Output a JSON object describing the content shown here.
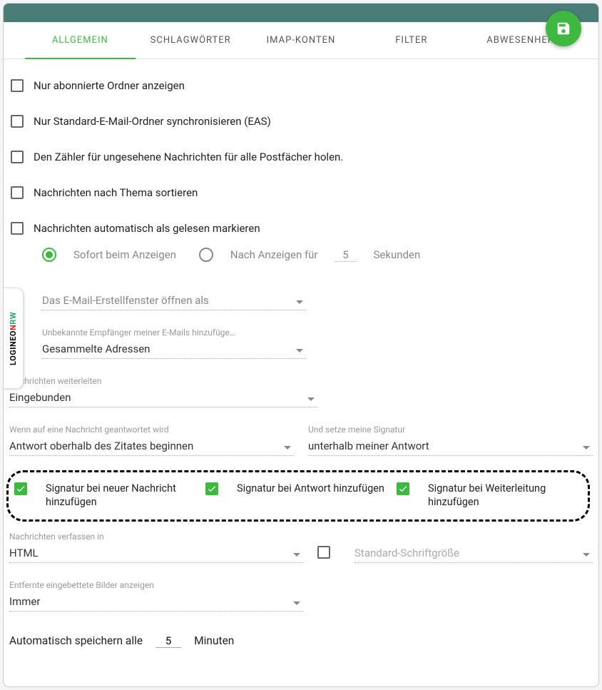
{
  "tabs": [
    "ALLGEMEIN",
    "SCHLAGWÖRTER",
    "IMAP-KONTEN",
    "FILTER",
    "ABWESENHEIT"
  ],
  "options": {
    "subscribed": "Nur abonnierte Ordner anzeigen",
    "standard": "Nur Standard-E-Mail-Ordner synchronisieren (EAS)",
    "counter": "Den Zähler für ungesehene Nachrichten für alle Postfächer holen.",
    "thread": "Nachrichten nach Thema sortieren",
    "autoread": "Nachrichten automatisch als gelesen markieren"
  },
  "radio": {
    "immediate": "Sofort beim Anzeigen",
    "after": "Nach Anzeigen für",
    "seconds_val": "5",
    "seconds": "Sekunden"
  },
  "compose_open": {
    "placeholder": "Das E-Mail-Erstellfenster öffnen als"
  },
  "unknown_recip": {
    "label": "Unbekannte Empfänger meiner E-Mails hinzufüge…",
    "value": "Gesammelte Adressen"
  },
  "forward": {
    "label": "Nachrichten weiterleiten",
    "value": "Eingebunden"
  },
  "reply": {
    "label": "Wenn auf eine Nachricht geantwortet wird",
    "value": "Antwort oberhalb des Zitates beginnen"
  },
  "sig_place": {
    "label": "Und setze meine Signatur",
    "value": "unterhalb meiner Antwort"
  },
  "sig": {
    "new": "Signatur bei neuer Nachricht hinzufügen",
    "reply": "Signatur bei Antwort hinzufügen",
    "fwd": "Signatur bei Weiterleitung hinzufügen"
  },
  "compose_fmt": {
    "label": "Nachrichten verfassen in",
    "value": "HTML"
  },
  "fontsize": {
    "placeholder": "Standard-Schriftgröße"
  },
  "remote_img": {
    "label": "Entfernte eingebettete Bilder anzeigen",
    "value": "Immer"
  },
  "autosave": {
    "label": "Automatisch speichern alle",
    "value": "5",
    "unit": "Minuten"
  },
  "sidetab": {
    "p1": "LOGINEO",
    "p2": "N",
    "p3": "RW"
  }
}
